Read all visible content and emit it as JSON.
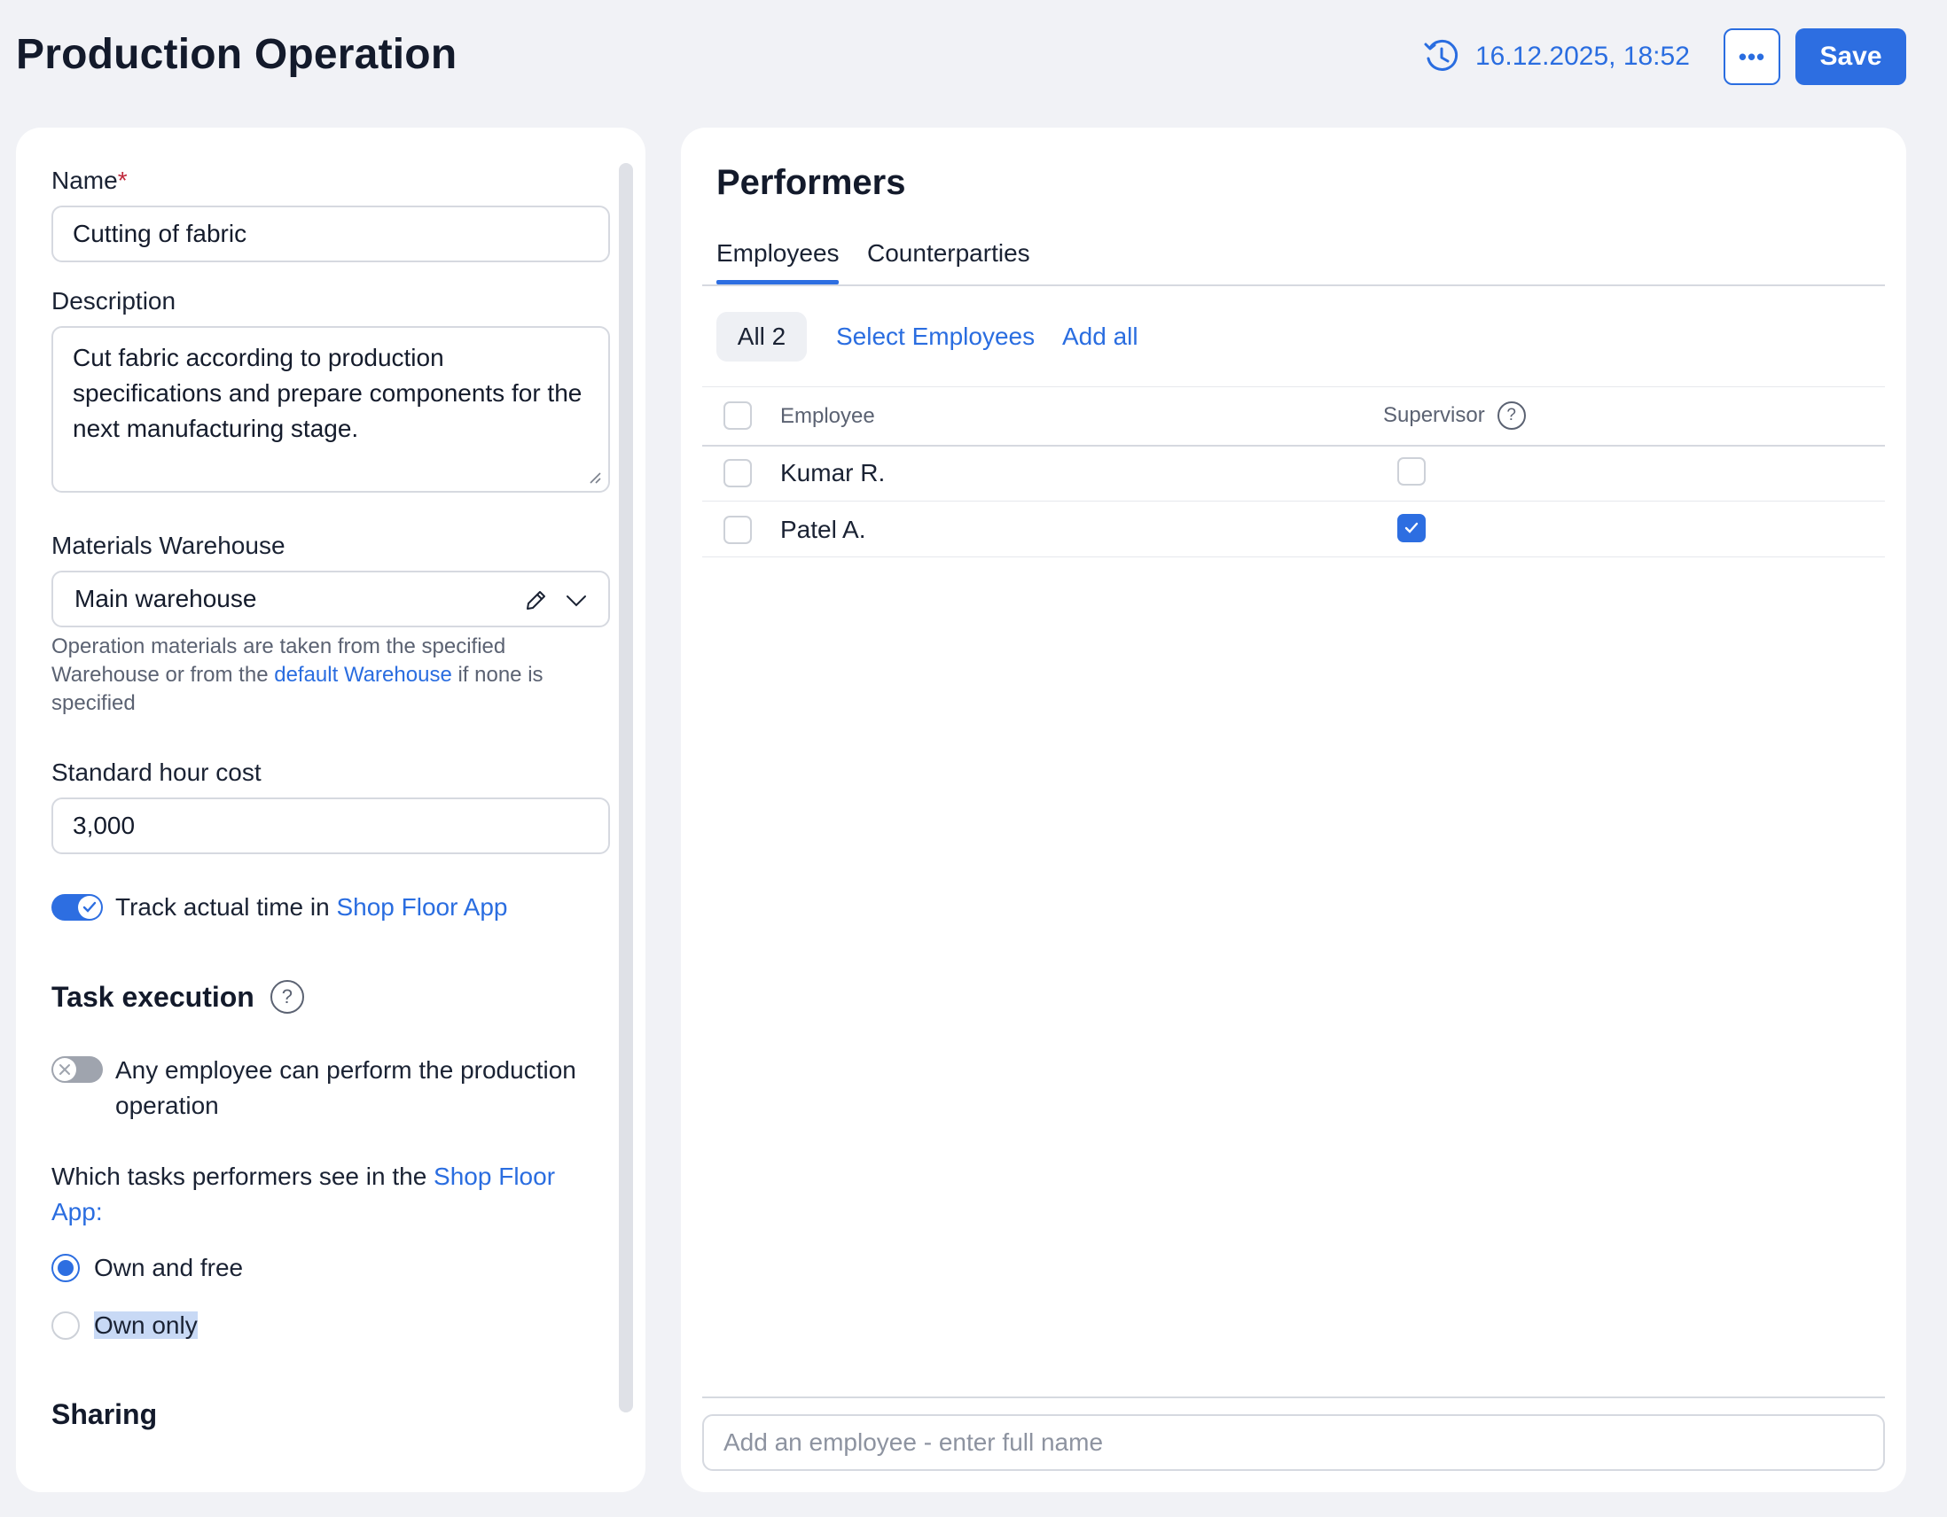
{
  "header": {
    "title": "Production Operation",
    "timestamp": "16.12.2025, 18:52",
    "more_label": "•••",
    "save_label": "Save"
  },
  "form": {
    "name": {
      "label": "Name",
      "required_mark": "*",
      "value": "Cutting of fabric"
    },
    "description": {
      "label": "Description",
      "value": "Cut fabric according to production specifications and prepare components for the next manufacturing stage."
    },
    "materials_warehouse": {
      "label": "Materials Warehouse",
      "value": "Main warehouse",
      "hint_before": "Operation materials are taken from the specified Warehouse or from the ",
      "hint_link": "default Warehouse",
      "hint_after": " if none is specified"
    },
    "standard_hour_cost": {
      "label": "Standard hour cost",
      "value": "3,000"
    },
    "track_time": {
      "text": "Track actual time in ",
      "link": "Shop Floor App",
      "enabled": true
    },
    "task_execution": {
      "title": "Task execution",
      "any_employee": {
        "text": "Any employee can perform the production operation",
        "enabled": false
      },
      "which_tasks_text": "Which tasks performers see in the ",
      "which_tasks_link": "Shop Floor App:",
      "options": [
        {
          "label": "Own and free",
          "selected": true
        },
        {
          "label": "Own only",
          "selected": false
        }
      ]
    },
    "sharing": {
      "title": "Sharing"
    }
  },
  "performers": {
    "title": "Performers",
    "tabs": [
      {
        "label": "Employees",
        "active": true
      },
      {
        "label": "Counterparties",
        "active": false
      }
    ],
    "filter_chip": "All 2",
    "select_employees_label": "Select Employees",
    "add_all_label": "Add all",
    "columns": {
      "employee": "Employee",
      "supervisor": "Supervisor"
    },
    "rows": [
      {
        "name": "Kumar R.",
        "supervisor": false
      },
      {
        "name": "Patel A.",
        "supervisor": true
      }
    ],
    "add_placeholder": "Add an employee - enter full name"
  },
  "colors": {
    "accent": "#2d6ee1",
    "background": "#f1f2f6",
    "required": "#c0283b"
  }
}
